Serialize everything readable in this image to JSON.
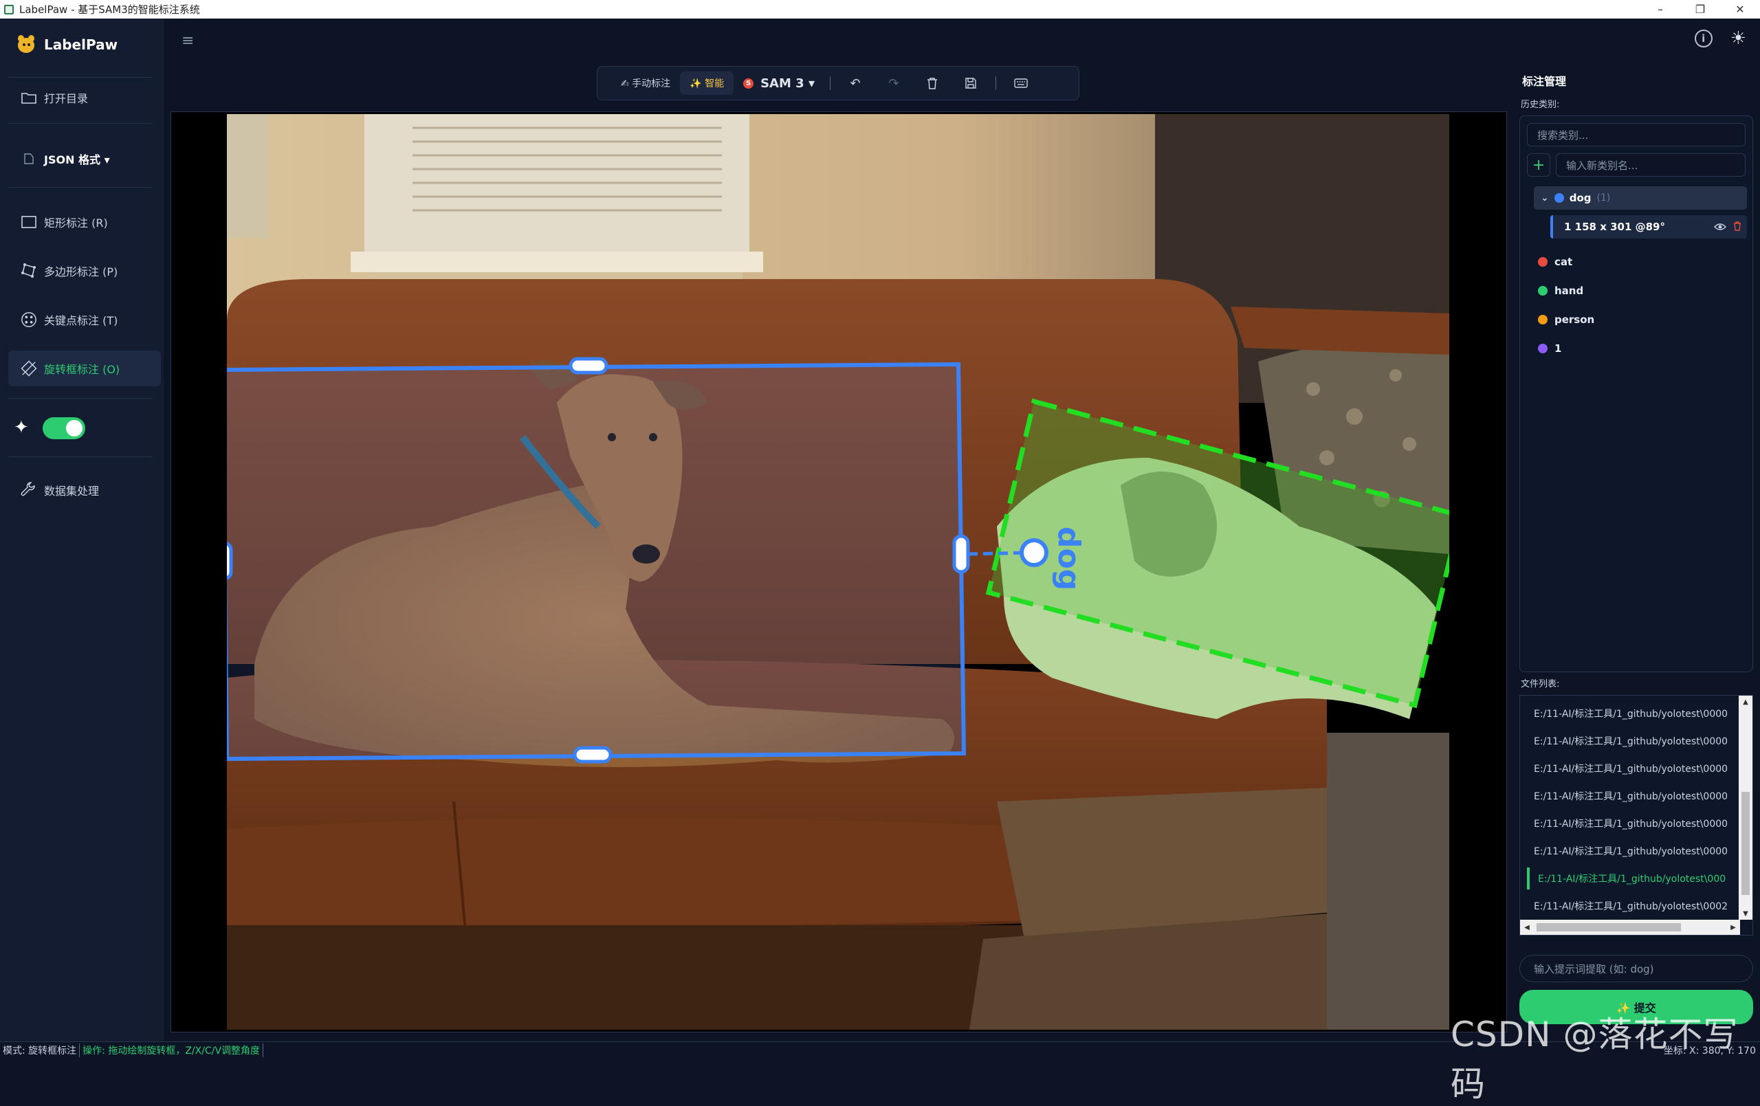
{
  "window": {
    "title": "LabelPaw - 基于SAM3的智能标注系统",
    "minimize": "–",
    "maximize": "❐",
    "close": "✕"
  },
  "sidebar": {
    "app_name": "LabelPaw",
    "open_dir": "打开目录",
    "format": "JSON 格式 ▾",
    "tools": [
      {
        "label": "矩形标注 (R)"
      },
      {
        "label": "多边形标注 (P)"
      },
      {
        "label": "关键点标注 (T)"
      },
      {
        "label": "旋转框标注 (O)",
        "active": true
      }
    ],
    "ai_toggle_on": true,
    "dataset": "数据集处理"
  },
  "header": {
    "menu_icon": "≡",
    "info_icon": "i",
    "theme_icon": "☀"
  },
  "toolbar": {
    "manual": "✍ 手动标注",
    "smart": "✨ 智能",
    "model": "SAM 3 ▾",
    "model_badge": "S",
    "undo": "↶",
    "redo": "↷",
    "delete": "🗑",
    "save": "💾",
    "keyboard": "⌨"
  },
  "canvas": {
    "label": "dog",
    "colors": {
      "selected": "#3b82f6",
      "other": "#22dd22"
    }
  },
  "right_panel": {
    "title": "标注管理",
    "history_label": "历史类别:",
    "search_placeholder": "搜索类别...",
    "new_class_placeholder": "输入新类别名...",
    "add": "+",
    "classes": [
      {
        "name": "dog",
        "count": "(1)",
        "color": "#3b82f6",
        "expanded": true
      },
      {
        "name": "cat",
        "color": "#e74c3c"
      },
      {
        "name": "hand",
        "color": "#2ecc71"
      },
      {
        "name": "person",
        "color": "#f39c12"
      },
      {
        "name": "1",
        "color": "#8b5cf6"
      }
    ],
    "instance": {
      "text": "1 158 x 301 @89°",
      "eye": "👁",
      "trash": "🗑"
    },
    "file_list_label": "文件列表:",
    "files": [
      "E:/11-AI/标注工具/1_github/yolotest\\0000",
      "E:/11-AI/标注工具/1_github/yolotest\\0000",
      "E:/11-AI/标注工具/1_github/yolotest\\0000",
      "E:/11-AI/标注工具/1_github/yolotest\\0000",
      "E:/11-AI/标注工具/1_github/yolotest\\0000",
      "E:/11-AI/标注工具/1_github/yolotest\\0000",
      "E:/11-AI/标注工具/1_github/yolotest\\000",
      "E:/11-AI/标注工具/1_github/yolotest\\0002"
    ],
    "current_file_index": 6,
    "prompt_placeholder": "输入提示词提取 (如: dog)",
    "submit": "✨ 提交"
  },
  "status": {
    "mode": "模式: 旋转框标注",
    "hint": "操作: 拖动绘制旋转框，Z/X/C/V调整角度",
    "coords": "坐标: X: 380, Y: 170"
  },
  "watermark": "CSDN @落花不写码"
}
